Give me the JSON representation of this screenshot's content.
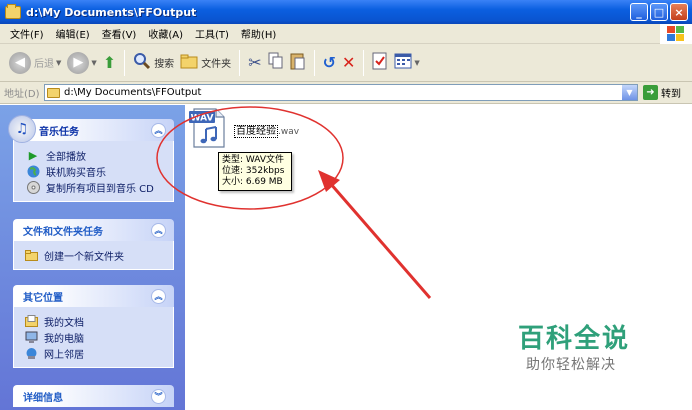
{
  "window": {
    "title": "d:\\My Documents\\FFOutput",
    "buttons": {
      "minimize": "_",
      "maximize": "□",
      "close": "×"
    }
  },
  "menu": {
    "items": [
      "文件(F)",
      "编辑(E)",
      "查看(V)",
      "收藏(A)",
      "工具(T)",
      "帮助(H)"
    ]
  },
  "toolbar": {
    "back_label": "后退",
    "search_label": "搜索",
    "folders_label": "文件夹"
  },
  "address": {
    "label": "地址(D)",
    "value": "d:\\My Documents\\FFOutput",
    "go_label": "转到"
  },
  "panes": {
    "music": {
      "title": "音乐任务",
      "tasks": [
        "全部播放",
        "联机购买音乐",
        "复制所有项目到音乐 CD"
      ]
    },
    "file_tasks": {
      "title": "文件和文件夹任务",
      "tasks": [
        "创建一个新文件夹"
      ]
    },
    "other_places": {
      "title": "其它位置",
      "places": [
        "我的文档",
        "我的电脑",
        "网上邻居"
      ]
    },
    "details": {
      "title": "详细信息"
    }
  },
  "file": {
    "icon_text": "WAV",
    "name": "百度经验",
    "ext": ".wav"
  },
  "tooltip": {
    "type": "类型: WAV文件",
    "bitrate": "位速: 352kbps",
    "size": "大小: 6.69 MB"
  },
  "watermark": {
    "title": "百科全说",
    "subtitle": "助你轻松解决"
  },
  "colors": {
    "titlebar": "#0b5fe0",
    "pane_bg": "#6f8ee0",
    "annotation_red": "#e0322f",
    "watermark_green": "#2fa07a"
  }
}
